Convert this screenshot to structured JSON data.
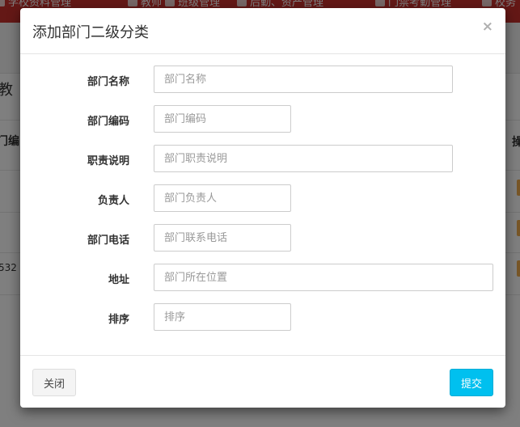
{
  "background": {
    "nav_items": [
      {
        "label": "学校资料管理",
        "icon": "list-icon"
      },
      {
        "label": "教师",
        "icon": "user-icon"
      },
      {
        "label": "班级管理",
        "icon": "users-icon"
      },
      {
        "label": "后勤、资产管理",
        "icon": "cube-icon"
      },
      {
        "label": "门禁考勤管理",
        "icon": "door-icon"
      },
      {
        "label": "校务",
        "icon": "file-icon"
      }
    ],
    "page_title": "教",
    "table_header_left": "门编",
    "table_header_right": "操",
    "row_value": "532"
  },
  "modal": {
    "title": "添加部门二级分类",
    "close_symbol": "×",
    "fields": {
      "name": {
        "label": "部门名称",
        "placeholder": "部门名称",
        "value": ""
      },
      "code": {
        "label": "部门编码",
        "placeholder": "部门编码",
        "value": ""
      },
      "duty": {
        "label": "职责说明",
        "placeholder": "部门职责说明",
        "value": ""
      },
      "leader": {
        "label": "负责人",
        "placeholder": "部门负责人",
        "value": ""
      },
      "phone": {
        "label": "部门电话",
        "placeholder": "部门联系电话",
        "value": ""
      },
      "address": {
        "label": "地址",
        "placeholder": "部门所在位置",
        "value": ""
      },
      "sort": {
        "label": "排序",
        "placeholder": "排序",
        "value": ""
      }
    },
    "buttons": {
      "close": "关闭",
      "submit": "提交"
    }
  },
  "colors": {
    "topbar": "#c9302c",
    "submit_button": "#00c0ef"
  }
}
